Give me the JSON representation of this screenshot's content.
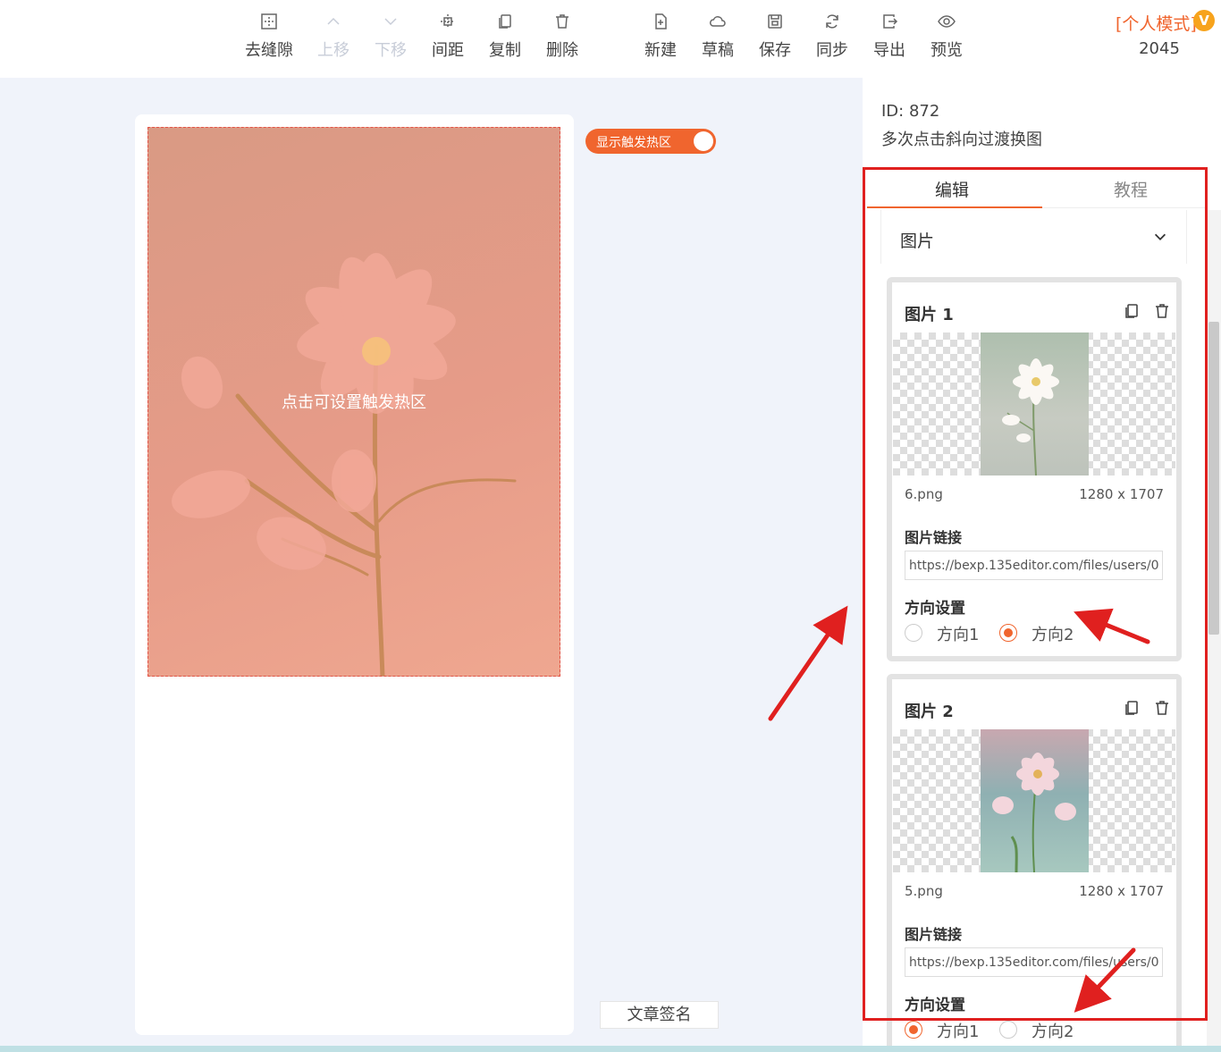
{
  "toolbar": {
    "items": [
      {
        "label": "去缝隙",
        "icon": "gap-icon",
        "disabled": false
      },
      {
        "label": "上移",
        "icon": "chevron-up-icon",
        "disabled": true
      },
      {
        "label": "下移",
        "icon": "chevron-down-icon",
        "disabled": true
      },
      {
        "label": "间距",
        "icon": "spacing-icon",
        "disabled": false
      },
      {
        "label": "复制",
        "icon": "copy-icon",
        "disabled": false
      },
      {
        "label": "删除",
        "icon": "trash-icon",
        "disabled": false
      },
      {
        "label": "新建",
        "icon": "new-file-icon",
        "disabled": false
      },
      {
        "label": "草稿",
        "icon": "cloud-icon",
        "disabled": false
      },
      {
        "label": "保存",
        "icon": "save-icon",
        "disabled": false
      },
      {
        "label": "同步",
        "icon": "sync-icon",
        "disabled": false
      },
      {
        "label": "导出",
        "icon": "export-icon",
        "disabled": false
      },
      {
        "label": "预览",
        "icon": "eye-icon",
        "disabled": false
      }
    ],
    "mode_label": "[个人模式]",
    "mode_badge": "V",
    "count": "2045"
  },
  "canvas": {
    "hotzone_hint": "点击可设置触发热区",
    "hotzone_toggle_label": "显示触发热区",
    "hotzone_toggle_on": true,
    "signature_button": "文章签名"
  },
  "panel": {
    "id_label": "ID: 872",
    "name": "多次点击斜向过渡换图",
    "tabs": [
      {
        "label": "编辑",
        "active": true
      },
      {
        "label": "教程",
        "active": false
      }
    ],
    "section_title": "图片",
    "cards": [
      {
        "title": "图片 1",
        "file_name": "6.png",
        "file_size": "1280 x 1707",
        "link_label": "图片链接",
        "link_value": "https://bexp.135editor.com/files/users/0...",
        "direction_label": "方向设置",
        "options": [
          "方向1",
          "方向2"
        ],
        "selected": "方向2"
      },
      {
        "title": "图片 2",
        "file_name": "5.png",
        "file_size": "1280 x 1707",
        "link_label": "图片链接",
        "link_value": "https://bexp.135editor.com/files/users/0...",
        "direction_label": "方向设置",
        "options": [
          "方向1",
          "方向2"
        ],
        "selected": "方向1"
      }
    ]
  },
  "colors": {
    "accent": "#f0652e",
    "annotation": "#e0201f",
    "background": "#f0f3fa"
  }
}
